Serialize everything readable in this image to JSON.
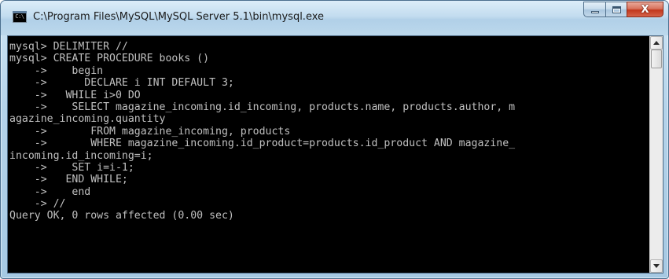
{
  "window": {
    "title": "C:\\Program Files\\MySQL\\MySQL Server 5.1\\bin\\mysql.exe",
    "app_icon_text": "C:\\",
    "controls": {
      "minimize_icon": "minimize-icon",
      "maximize_icon": "maximize-icon",
      "close_icon": "close-icon",
      "close_glyph": "X"
    }
  },
  "console": {
    "lines": [
      "mysql> DELIMITER //",
      "mysql> CREATE PROCEDURE books ()",
      "    ->    begin",
      "    ->      DECLARE i INT DEFAULT 3;",
      "    ->   WHILE i>0 DO",
      "    ->    SELECT magazine_incoming.id_incoming, products.name, products.author, m",
      "agazine_incoming.quantity",
      "    ->       FROM magazine_incoming, products",
      "    ->       WHERE magazine_incoming.id_product=products.id_product AND magazine_",
      "incoming.id_incoming=i;",
      "    ->    SET i=i-1;",
      "    ->   END WHILE;",
      "    ->    end",
      "    -> //",
      "Query OK, 0 rows affected (0.00 sec)"
    ]
  },
  "scrollbar": {
    "position_fraction": 0.0,
    "visible_fraction": 0.09
  },
  "colors": {
    "console_background": "#000000",
    "console_text": "#c0c0c0",
    "close_button": "#c2381d",
    "frame": "#b4d3ea"
  }
}
